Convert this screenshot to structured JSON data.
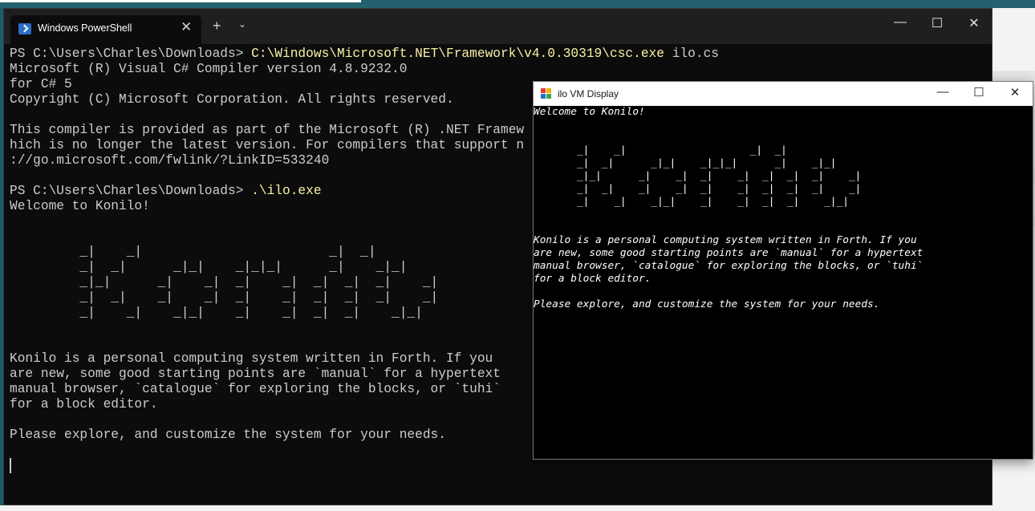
{
  "terminal": {
    "tab_title": "Windows PowerShell",
    "tab_close": "✕",
    "new_tab": "+",
    "dropdown": "⌄",
    "minimize": "—",
    "maximize": "☐",
    "close": "✕",
    "lines": [
      {
        "text": "PS C:\\Users\\Charles\\Downloads> ",
        "cmd": "C:\\Windows\\Microsoft.NET\\Framework\\v4.0.30319\\csc.exe",
        "rest": " ilo.cs"
      },
      {
        "text": "Microsoft (R) Visual C# Compiler version 4.8.9232.0"
      },
      {
        "text": "for C# 5"
      },
      {
        "text": "Copyright (C) Microsoft Corporation. All rights reserved."
      },
      {
        "text": ""
      },
      {
        "text": "This compiler is provided as part of the Microsoft (R) .NET Framew"
      },
      {
        "text": "hich is no longer the latest version. For compilers that support n"
      },
      {
        "text": "://go.microsoft.com/fwlink/?LinkID=533240"
      },
      {
        "text": ""
      },
      {
        "text": "PS C:\\Users\\Charles\\Downloads> ",
        "cmd": ".\\ilo.exe",
        "rest": ""
      },
      {
        "text": "Welcome to Konilo!"
      },
      {
        "text": ""
      },
      {
        "text": ""
      },
      {
        "text": "         _|    _|                        _|  _|"
      },
      {
        "text": "         _|  _|      _|_|    _|_|_|      _|    _|_|"
      },
      {
        "text": "         _|_|      _|    _|  _|    _|  _|  _|  _|    _|"
      },
      {
        "text": "         _|  _|    _|    _|  _|    _|  _|  _|  _|    _|"
      },
      {
        "text": "         _|    _|    _|_|    _|    _|  _|  _|    _|_|"
      },
      {
        "text": ""
      },
      {
        "text": ""
      },
      {
        "text": "Konilo is a personal computing system written in Forth. If you"
      },
      {
        "text": "are new, some good starting points are `manual` for a hypertext"
      },
      {
        "text": "manual browser, `catalogue` for exploring the blocks, or `tuhi`"
      },
      {
        "text": "for a block editor."
      },
      {
        "text": ""
      },
      {
        "text": "Please explore, and customize the system for your needs."
      },
      {
        "text": ""
      }
    ]
  },
  "vm_window": {
    "title": "ilo VM Display",
    "minimize": "—",
    "maximize": "☐",
    "close": "✕",
    "lines": [
      "Welcome to Konilo!",
      "",
      "",
      "       _|    _|                    _|  _|",
      "       _|  _|      _|_|    _|_|_|      _|    _|_|",
      "       _|_|      _|    _|  _|    _|  _|  _|  _|    _|",
      "       _|  _|    _|    _|  _|    _|  _|  _|  _|    _|",
      "       _|    _|    _|_|    _|    _|  _|  _|    _|_|",
      "",
      "",
      "Konilo is a personal computing system written in Forth. If you",
      "are new, some good starting points are `manual` for a hypertext",
      "manual browser, `catalogue` for exploring the blocks, or `tuhi`",
      "for a block editor.",
      "",
      "Please explore, and customize the system for your needs."
    ]
  },
  "colors": {
    "terminal_bg": "#0c0c0c",
    "terminal_text": "#cccccc",
    "command_highlight": "#f9f1a5",
    "vm_bg": "#000000",
    "vm_text": "#ffffff"
  },
  "icons": {
    "terminal_tab_icon": "powershell-icon",
    "vm_icon": "app-window-icon"
  }
}
